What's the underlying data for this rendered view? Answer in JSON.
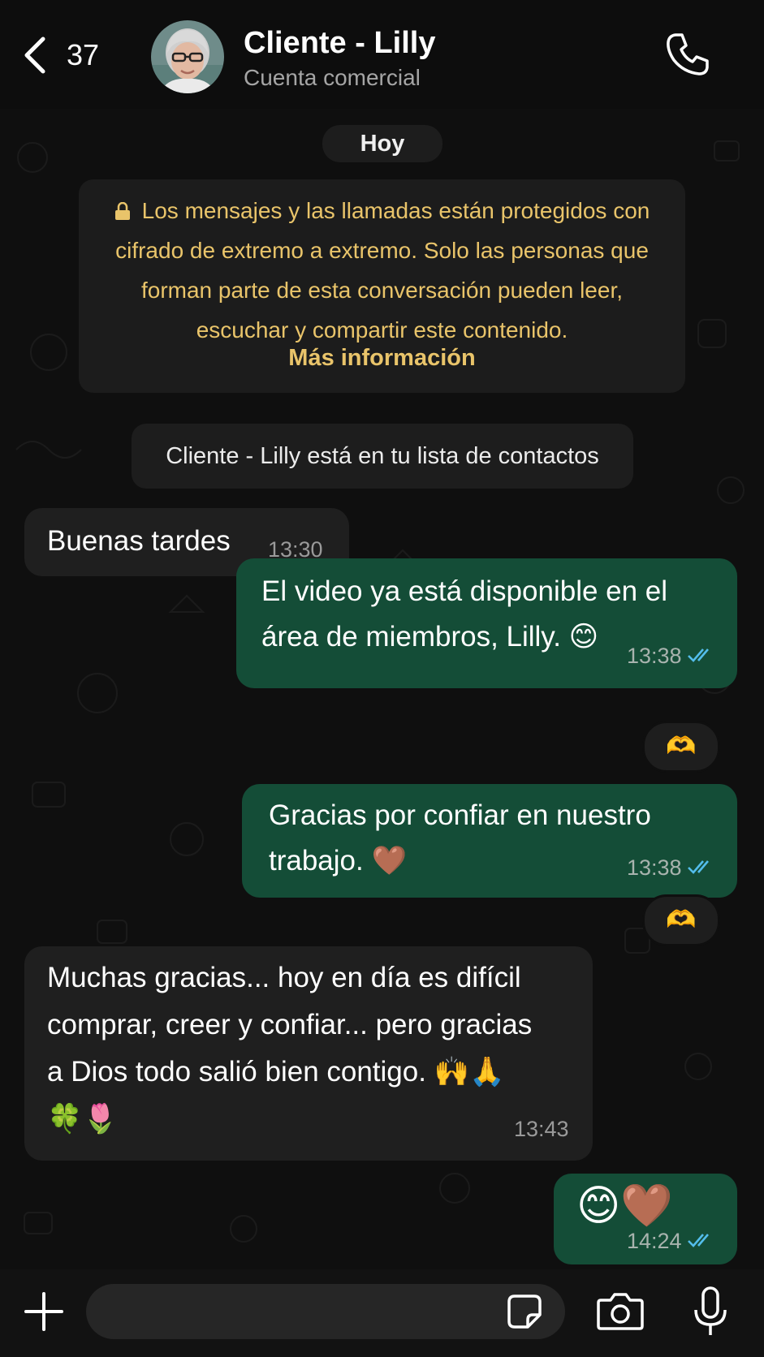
{
  "header": {
    "back_count": "37",
    "contact_name": "Cliente - Lilly",
    "contact_subtitle": "Cuenta comercial",
    "back_icon": "chevron-left-icon",
    "call_icon": "phone-icon"
  },
  "chat": {
    "date_label": "Hoy",
    "encryption_notice": "Los mensajes y las llamadas están protegidos con cifrado de extremo a extremo. Solo las personas que forman parte de esta conversación pueden leer, escuchar y compartir este contenido.",
    "encryption_link": "Más información",
    "contact_notice": "Cliente - Lilly está en tu lista de contactos",
    "messages": [
      {
        "direction": "incoming",
        "text": "Buenas tardes",
        "time": "13:30"
      },
      {
        "direction": "outgoing",
        "text_line1": "El video ya está disponible en el",
        "text_line2": "área de miembros, Lilly. 😊",
        "time": "13:38",
        "reaction": "🫶"
      },
      {
        "direction": "outgoing",
        "text_line1": "Gracias por confiar en nuestro",
        "text_line2": "trabajo. 🤎",
        "time": "13:38",
        "reaction": "🫶"
      },
      {
        "direction": "incoming",
        "text_line1": "Muchas gracias... hoy en día es difícil",
        "text_line2": "comprar, creer y confiar... pero gracias",
        "text_line3": "a Dios todo salió bien contigo. 🙌🙏",
        "text_line4": "🍀🌷",
        "time": "13:43"
      },
      {
        "direction": "outgoing",
        "text": "😊🤎",
        "time": "14:24"
      }
    ]
  },
  "composer": {
    "attach_icon": "plus-icon",
    "sticker_icon": "sticker-icon",
    "camera_icon": "camera-icon",
    "mic_icon": "microphone-icon"
  },
  "colors": {
    "background": "#0b0b0b",
    "outgoing_bubble": "#144d37",
    "incoming_bubble": "#1f1f1f",
    "notice_text": "#e9c46a",
    "read_ticks": "#53bdeb"
  }
}
